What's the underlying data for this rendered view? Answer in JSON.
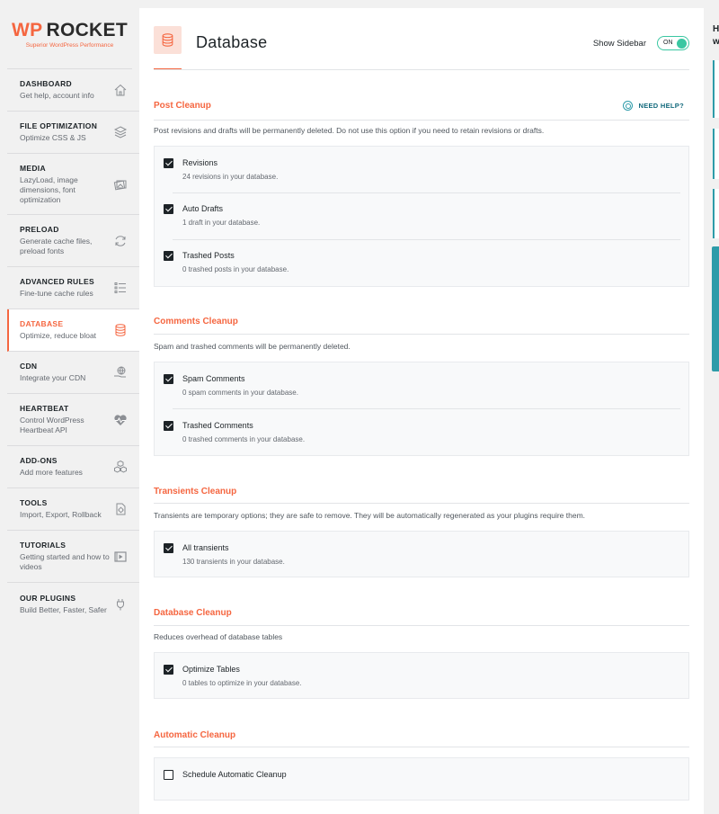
{
  "brand": {
    "wp": "WP",
    "name": "ROCKET",
    "tagline": "Superior WordPress Performance"
  },
  "sidebar": {
    "items": [
      {
        "title": "DASHBOARD",
        "desc": "Get help, account info",
        "icon": "home-icon"
      },
      {
        "title": "FILE OPTIMIZATION",
        "desc": "Optimize CSS & JS",
        "icon": "layers-icon"
      },
      {
        "title": "MEDIA",
        "desc": "LazyLoad, image dimensions, font optimization",
        "icon": "images-icon"
      },
      {
        "title": "PRELOAD",
        "desc": "Generate cache files, preload fonts",
        "icon": "refresh-icon"
      },
      {
        "title": "ADVANCED RULES",
        "desc": "Fine-tune cache rules",
        "icon": "list-icon"
      },
      {
        "title": "DATABASE",
        "desc": "Optimize, reduce bloat",
        "icon": "database-icon",
        "active": true
      },
      {
        "title": "CDN",
        "desc": "Integrate your CDN",
        "icon": "globe-hand-icon"
      },
      {
        "title": "HEARTBEAT",
        "desc": "Control WordPress Heartbeat API",
        "icon": "heartbeat-icon"
      },
      {
        "title": "ADD-ONS",
        "desc": "Add more features",
        "icon": "cubes-icon"
      },
      {
        "title": "TOOLS",
        "desc": "Import, Export, Rollback",
        "icon": "tools-icon"
      },
      {
        "title": "TUTORIALS",
        "desc": "Getting started and how to videos",
        "icon": "video-icon"
      },
      {
        "title": "OUR PLUGINS",
        "desc": "Build Better, Faster, Safer",
        "icon": "plug-icon"
      }
    ]
  },
  "header": {
    "title": "Database",
    "show_sidebar_label": "Show Sidebar",
    "toggle_label": "ON",
    "toggle_on": true
  },
  "help_label": "NEED HELP?",
  "sections": {
    "post": {
      "title": "Post Cleanup",
      "desc": "Post revisions and drafts will be permanently deleted. Do not use this option if you need to retain revisions or drafts.",
      "options": [
        {
          "label": "Revisions",
          "desc": "24 revisions in your database.",
          "checked": true
        },
        {
          "label": "Auto Drafts",
          "desc": "1 draft in your database.",
          "checked": true
        },
        {
          "label": "Trashed Posts",
          "desc": "0 trashed posts in your database.",
          "checked": true
        }
      ]
    },
    "comments": {
      "title": "Comments Cleanup",
      "desc": "Spam and trashed comments will be permanently deleted.",
      "options": [
        {
          "label": "Spam Comments",
          "desc": "0 spam comments in your database.",
          "checked": true
        },
        {
          "label": "Trashed Comments",
          "desc": "0 trashed comments in your database.",
          "checked": true
        }
      ]
    },
    "transients": {
      "title": "Transients Cleanup",
      "desc": "Transients are temporary options; they are safe to remove. They will be automatically regenerated as your plugins require them.",
      "options": [
        {
          "label": "All transients",
          "desc": "130 transients in your database.",
          "checked": true
        }
      ]
    },
    "database": {
      "title": "Database Cleanup",
      "desc": "Reduces overhead of database tables",
      "options": [
        {
          "label": "Optimize Tables",
          "desc": "0 tables to optimize in your database.",
          "checked": true
        }
      ]
    },
    "automatic": {
      "title": "Automatic Cleanup",
      "options": [
        {
          "label": "Schedule Automatic Cleanup",
          "checked": false
        }
      ]
    }
  },
  "rightbar": {
    "letter1": "H",
    "letter2": "w"
  },
  "colors": {
    "accent": "#f56640",
    "teal": "#2e9ba9",
    "toggle": "#3ac7a2"
  }
}
